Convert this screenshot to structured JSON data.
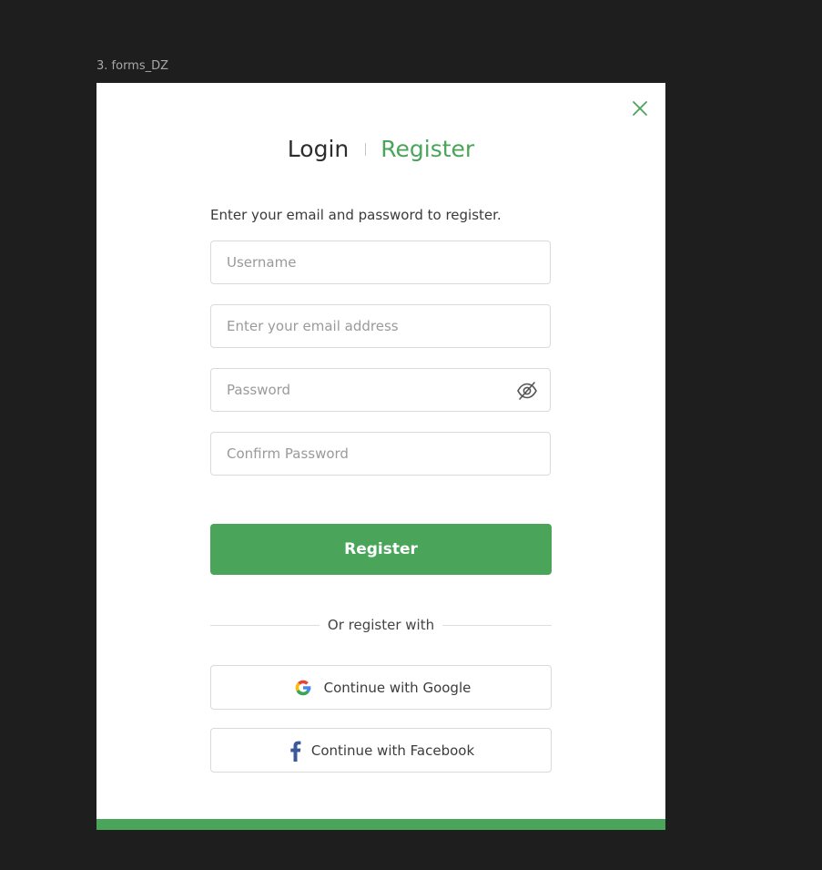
{
  "frame_label": "3. forms_DZ",
  "modal": {
    "close_icon": "close-icon",
    "tabs": {
      "login": "Login",
      "register": "Register",
      "active": "register"
    },
    "instruction": "Enter your email and password to register.",
    "fields": {
      "username": {
        "placeholder": "Username",
        "value": ""
      },
      "email": {
        "placeholder": "Enter your email address",
        "value": ""
      },
      "password": {
        "placeholder": "Password",
        "value": "",
        "toggle_icon": "eye-off-icon"
      },
      "confirm_password": {
        "placeholder": "Confirm Password",
        "value": ""
      }
    },
    "primary_button": "Register",
    "divider_text": "Or register with",
    "social": {
      "google": {
        "label": "Continue with Google",
        "icon": "google-icon"
      },
      "facebook": {
        "label": "Continue with Facebook",
        "icon": "facebook-icon"
      }
    }
  },
  "colors": {
    "accent": "#4aa55a",
    "background": "#1e1e1e",
    "modal": "#ffffff",
    "text_dark": "#2d2d2d",
    "input_border": "#dadada"
  }
}
